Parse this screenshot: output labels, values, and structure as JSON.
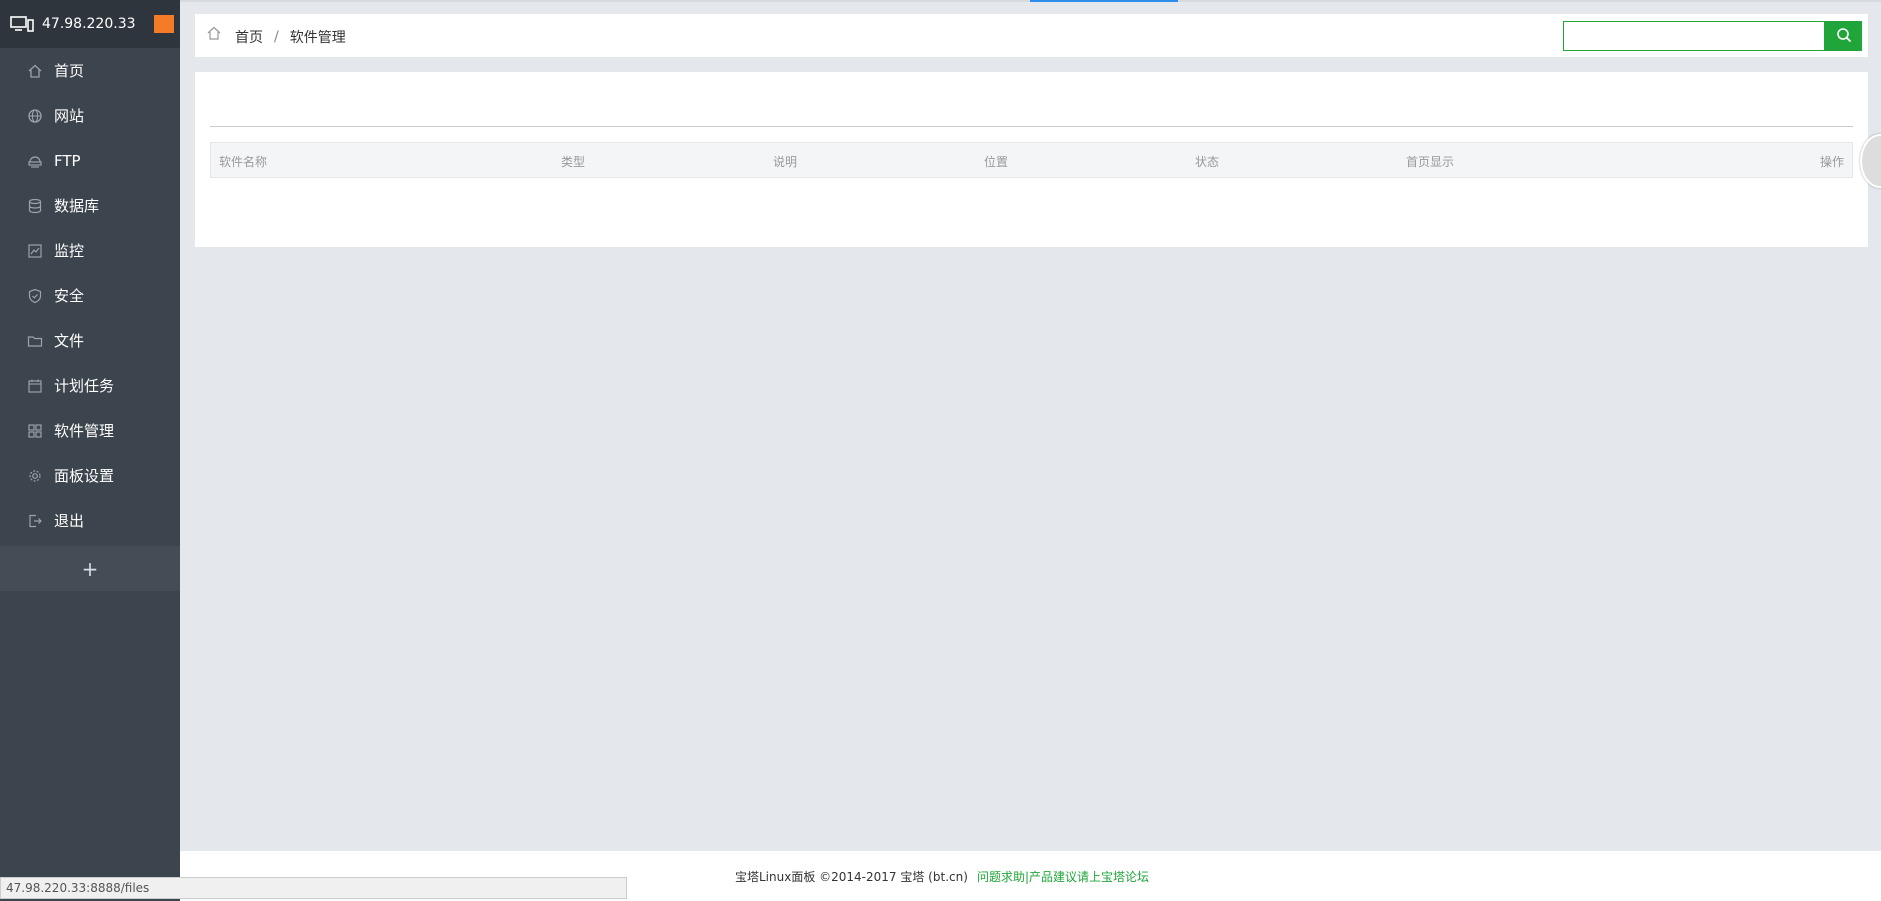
{
  "sidebar": {
    "host": "47.98.220.33",
    "items": [
      {
        "label": "首页",
        "icon": "home-icon"
      },
      {
        "label": "网站",
        "icon": "globe-icon"
      },
      {
        "label": "FTP",
        "icon": "ftp-icon"
      },
      {
        "label": "数据库",
        "icon": "database-icon"
      },
      {
        "label": "监控",
        "icon": "monitor-chart-icon"
      },
      {
        "label": "安全",
        "icon": "shield-icon"
      },
      {
        "label": "文件",
        "icon": "folder-icon"
      },
      {
        "label": "计划任务",
        "icon": "calendar-icon"
      },
      {
        "label": "软件管理",
        "icon": "grid-icon"
      },
      {
        "label": "面板设置",
        "icon": "gear-icon"
      },
      {
        "label": "退出",
        "icon": "logout-icon"
      }
    ],
    "add_label": "+"
  },
  "breadcrumb": {
    "home": "首页",
    "sep": "/",
    "current": "软件管理"
  },
  "search": {
    "value": "",
    "placeholder": ""
  },
  "table": {
    "columns": [
      "软件名称",
      "类型",
      "说明",
      "位置",
      "状态",
      "首页显示",
      "操作"
    ]
  },
  "footer": {
    "copyright": "宝塔Linux面板 ©2014-2017 宝塔 (bt.cn)",
    "help": "问题求助|产品建议请上宝塔论坛"
  },
  "statusbar": {
    "url": "47.98.220.33:8888/files"
  },
  "colors": {
    "accent": "#20a53a",
    "sidebar_bg": "#3c444d",
    "flag": "#f57c27"
  }
}
